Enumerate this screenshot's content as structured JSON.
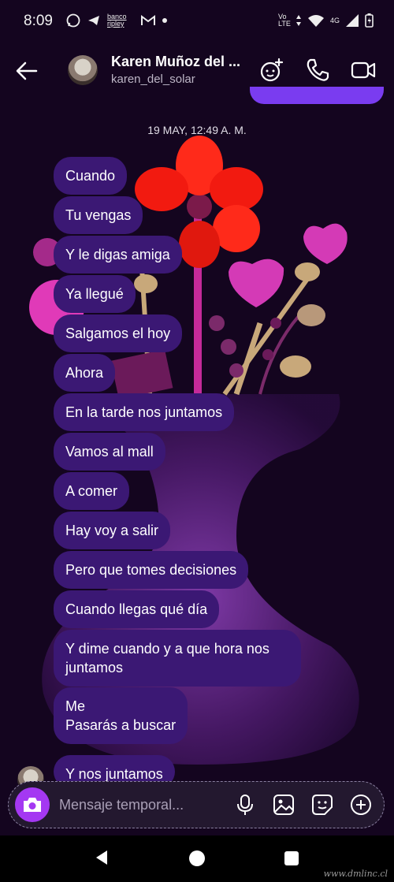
{
  "status_bar": {
    "time": "8:09",
    "left_badge": "banco ripley",
    "network_volte": "Vo LTE",
    "network_4g": "4G"
  },
  "header": {
    "name": "Karen Muñoz del ...",
    "handle": "karen_del_solar"
  },
  "chat": {
    "date": "19 MAY, 12:49 A. M.",
    "messages": [
      "Cuando",
      "Tu vengas",
      "Y le digas amiga",
      "Ya llegué",
      "Salgamos el hoy",
      "Ahora",
      "En la tarde nos juntamos",
      "Vamos al mall",
      "A comer",
      "Hay voy a salir",
      "Pero que tomes decisiones",
      "Cuando llegas qué día",
      "Y dime cuando y a que hora nos juntamos",
      "Me\nPasarás a buscar",
      "Y nos juntamos"
    ]
  },
  "composer": {
    "placeholder": "Mensaje temporal..."
  },
  "watermark": "www.dmlinc.cl",
  "colors": {
    "background": "#14051f",
    "bubble": "#3b1874",
    "accent": "#a438f2",
    "prev_bubble": "#7a3cf0"
  }
}
